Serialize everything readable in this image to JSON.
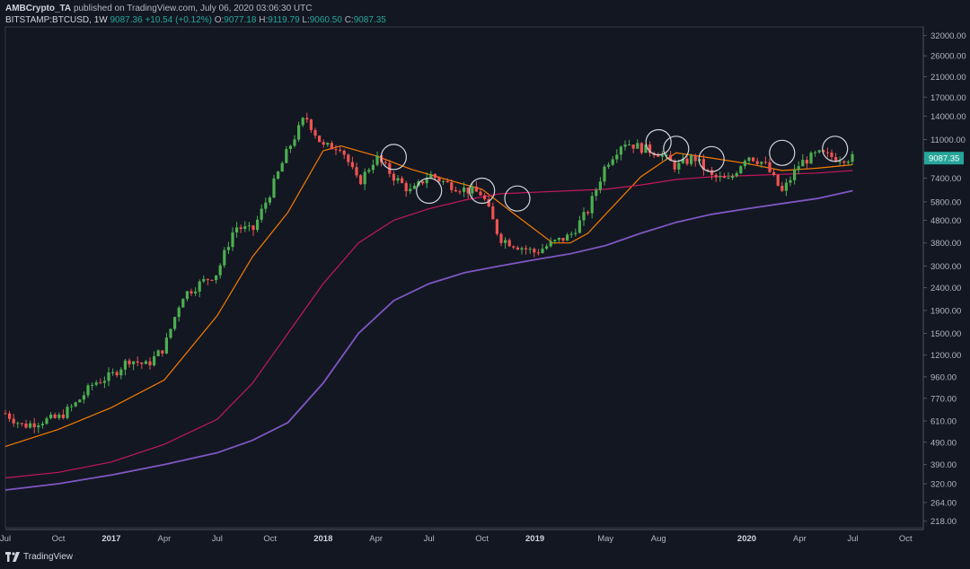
{
  "header": {
    "author": "AMBCrypto_TA",
    "published": "published on TradingView.com, July 06, 2020 03:06:30 UTC"
  },
  "ohlc": {
    "symbol": "BITSTAMP:BTCUSD, 1W",
    "last": "9087.36",
    "change": "+10.54 (+0.12%)",
    "o_label": "O:",
    "o": "9077.18",
    "h_label": "H:",
    "h": "9119.79",
    "l_label": "L:",
    "l": "9060.50",
    "c_label": "C:",
    "c": "9087.35"
  },
  "footer": {
    "brand": "TradingView"
  },
  "colors": {
    "background": "#131722",
    "up": "#26a69a",
    "up_body": "#4caf50",
    "down": "#ef5350",
    "ma_orange": "#f57c00",
    "ma_red": "#c2185b",
    "ma_purple": "#7e57c2",
    "price_label_bg": "#26a69a",
    "circle": "#d1d4dc"
  },
  "chart_data": {
    "type": "candlestick",
    "title": "",
    "xlabel": "",
    "ylabel": "",
    "y_scale": "log",
    "ylim": [
      200,
      35000
    ],
    "x_range": [
      "2016-07",
      "2020-11"
    ],
    "x_tick_labels": [
      "Jul",
      "Oct",
      "2017",
      "Apr",
      "Jul",
      "Oct",
      "2018",
      "Apr",
      "Jul",
      "Oct",
      "2019",
      "May",
      "Aug",
      "2020",
      "Apr",
      "Jul",
      "Oct"
    ],
    "x_tick_dates": [
      "2016-07",
      "2016-10",
      "2017-01",
      "2017-04",
      "2017-07",
      "2017-10",
      "2018-01",
      "2018-04",
      "2018-07",
      "2018-10",
      "2019-01",
      "2019-05",
      "2019-08",
      "2020-01",
      "2020-04",
      "2020-07",
      "2020-10"
    ],
    "y_tick_labels": [
      "32000.00",
      "26000.00",
      "21000.00",
      "17000.00",
      "14000.00",
      "11000.00",
      "9000.00",
      "7400.00",
      "5800.00",
      "4800.00",
      "3800.00",
      "3000.00",
      "2400.00",
      "1900.00",
      "1500.00",
      "1200.00",
      "960.00",
      "770.00",
      "610.00",
      "490.00",
      "390.00",
      "320.00",
      "264.00",
      "218.00"
    ],
    "last_price_label": "9087.35",
    "series": [
      {
        "name": "",
        "kind": "ma",
        "color": "#f57c00",
        "points": [
          [
            "2016-07",
            470
          ],
          [
            "2016-10",
            560
          ],
          [
            "2017-01",
            700
          ],
          [
            "2017-04",
            930
          ],
          [
            "2017-07",
            1800
          ],
          [
            "2017-09",
            3300
          ],
          [
            "2017-11",
            5200
          ],
          [
            "2018-01",
            9800
          ],
          [
            "2018-02",
            10300
          ],
          [
            "2018-04",
            9300
          ],
          [
            "2018-06",
            8100
          ],
          [
            "2018-08",
            7300
          ],
          [
            "2018-10",
            6600
          ],
          [
            "2018-12",
            5000
          ],
          [
            "2019-02",
            3800
          ],
          [
            "2019-03",
            3800
          ],
          [
            "2019-04",
            4200
          ],
          [
            "2019-05",
            5100
          ],
          [
            "2019-07",
            7500
          ],
          [
            "2019-09",
            9600
          ],
          [
            "2019-11",
            9100
          ],
          [
            "2020-01",
            8600
          ],
          [
            "2020-03",
            8000
          ],
          [
            "2020-05",
            8200
          ],
          [
            "2020-07",
            8500
          ]
        ]
      },
      {
        "name": "",
        "kind": "ma",
        "color": "#c2185b",
        "points": [
          [
            "2016-07",
            340
          ],
          [
            "2016-10",
            360
          ],
          [
            "2017-01",
            400
          ],
          [
            "2017-04",
            480
          ],
          [
            "2017-07",
            620
          ],
          [
            "2017-09",
            900
          ],
          [
            "2017-11",
            1500
          ],
          [
            "2018-01",
            2500
          ],
          [
            "2018-03",
            3800
          ],
          [
            "2018-05",
            4800
          ],
          [
            "2018-07",
            5400
          ],
          [
            "2018-09",
            5900
          ],
          [
            "2018-11",
            6300
          ],
          [
            "2019-01",
            6400
          ],
          [
            "2019-03",
            6500
          ],
          [
            "2019-05",
            6600
          ],
          [
            "2019-07",
            6900
          ],
          [
            "2019-09",
            7300
          ],
          [
            "2019-11",
            7500
          ],
          [
            "2020-01",
            7600
          ],
          [
            "2020-03",
            7700
          ],
          [
            "2020-05",
            7800
          ],
          [
            "2020-07",
            8000
          ]
        ]
      },
      {
        "name": "",
        "kind": "ma",
        "color": "#7e57c2",
        "points": [
          [
            "2016-07",
            300
          ],
          [
            "2016-10",
            320
          ],
          [
            "2017-01",
            350
          ],
          [
            "2017-04",
            390
          ],
          [
            "2017-07",
            440
          ],
          [
            "2017-09",
            500
          ],
          [
            "2017-11",
            600
          ],
          [
            "2018-01",
            900
          ],
          [
            "2018-03",
            1500
          ],
          [
            "2018-05",
            2100
          ],
          [
            "2018-07",
            2500
          ],
          [
            "2018-09",
            2800
          ],
          [
            "2018-11",
            3000
          ],
          [
            "2019-01",
            3200
          ],
          [
            "2019-03",
            3400
          ],
          [
            "2019-05",
            3700
          ],
          [
            "2019-07",
            4200
          ],
          [
            "2019-09",
            4700
          ],
          [
            "2019-11",
            5100
          ],
          [
            "2020-01",
            5400
          ],
          [
            "2020-03",
            5700
          ],
          [
            "2020-05",
            6000
          ],
          [
            "2020-07",
            6500
          ]
        ]
      },
      {
        "name": "",
        "kind": "price",
        "color": "#26a69a",
        "points": [
          [
            "2016-07",
            660
          ],
          [
            "2016-08",
            580
          ],
          [
            "2016-09",
            610
          ],
          [
            "2016-10",
            630
          ],
          [
            "2016-11",
            730
          ],
          [
            "2016-12",
            900
          ],
          [
            "2017-01",
            970
          ],
          [
            "2017-02",
            1150
          ],
          [
            "2017-03",
            1080
          ],
          [
            "2017-04",
            1300
          ],
          [
            "2017-05",
            2200
          ],
          [
            "2017-06",
            2500
          ],
          [
            "2017-07",
            2800
          ],
          [
            "2017-08",
            4500
          ],
          [
            "2017-09",
            4300
          ],
          [
            "2017-10",
            6400
          ],
          [
            "2017-11",
            9900
          ],
          [
            "2017-12",
            14000
          ],
          [
            "2018-01",
            10200
          ],
          [
            "2018-02",
            10300
          ],
          [
            "2018-03",
            7000
          ],
          [
            "2018-04",
            9200
          ],
          [
            "2018-05",
            7500
          ],
          [
            "2018-06",
            6400
          ],
          [
            "2018-07",
            7700
          ],
          [
            "2018-08",
            7000
          ],
          [
            "2018-09",
            6600
          ],
          [
            "2018-10",
            6300
          ],
          [
            "2018-11",
            4000
          ],
          [
            "2018-12",
            3700
          ],
          [
            "2019-01",
            3450
          ],
          [
            "2019-02",
            3800
          ],
          [
            "2019-03",
            4100
          ],
          [
            "2019-04",
            5300
          ],
          [
            "2019-05",
            8500
          ],
          [
            "2019-06",
            10800
          ],
          [
            "2019-07",
            10100
          ],
          [
            "2019-08",
            9600
          ],
          [
            "2019-09",
            8300
          ],
          [
            "2019-10",
            9200
          ],
          [
            "2019-11",
            7500
          ],
          [
            "2019-12",
            7200
          ],
          [
            "2020-01",
            9400
          ],
          [
            "2020-02",
            8600
          ],
          [
            "2020-03",
            6400
          ],
          [
            "2020-04",
            8600
          ],
          [
            "2020-05",
            9500
          ],
          [
            "2020-06",
            9150
          ],
          [
            "2020-07",
            9087
          ]
        ]
      }
    ],
    "annotations": [
      {
        "type": "circle",
        "x": "2018-05",
        "y": 9200
      },
      {
        "type": "circle",
        "x": "2018-07",
        "y": 6500
      },
      {
        "type": "circle",
        "x": "2018-10",
        "y": 6500
      },
      {
        "type": "circle",
        "x": "2018-12",
        "y": 6000
      },
      {
        "type": "circle",
        "x": "2019-08",
        "y": 10700
      },
      {
        "type": "circle",
        "x": "2019-09",
        "y": 10000
      },
      {
        "type": "circle",
        "x": "2019-11",
        "y": 9000
      },
      {
        "type": "circle",
        "x": "2020-03",
        "y": 9600
      },
      {
        "type": "circle",
        "x": "2020-06",
        "y": 10000
      }
    ]
  }
}
